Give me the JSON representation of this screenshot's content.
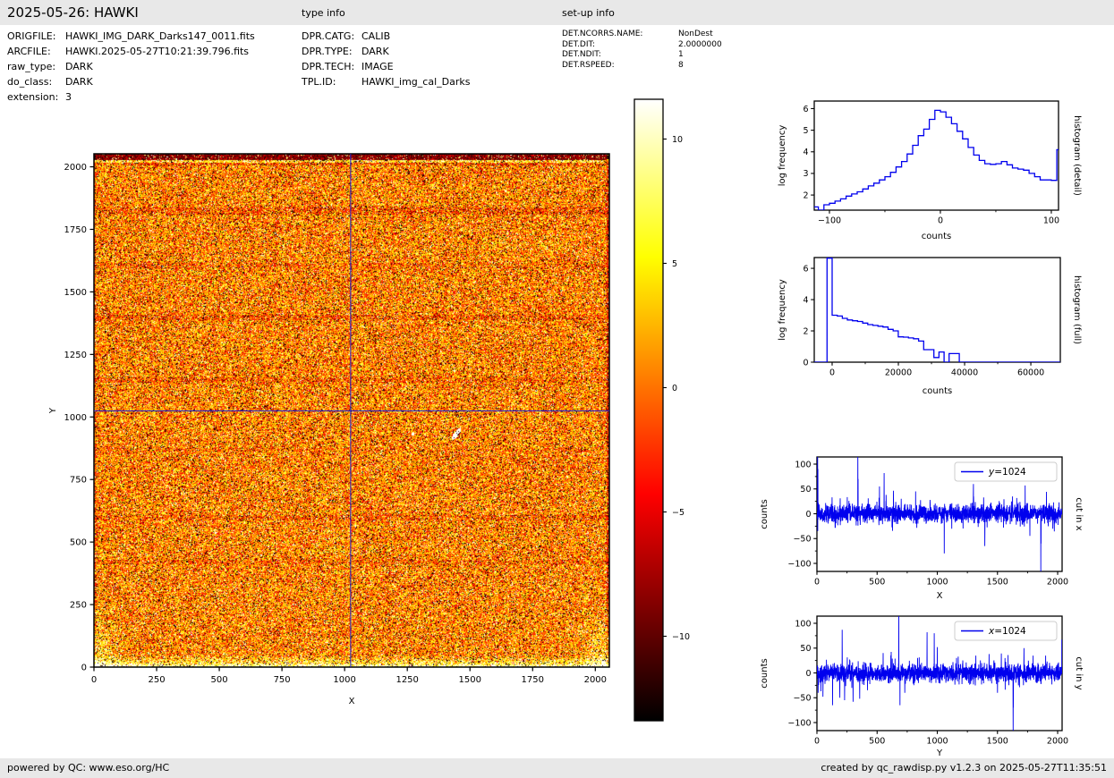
{
  "header": {
    "title": "2025-05-26: HAWKI",
    "type_info_label": "type info",
    "setup_info_label": "set-up info"
  },
  "file_info": {
    "rows": [
      {
        "label": "ORIGFILE:",
        "value": "HAWKI_IMG_DARK_Darks147_0011.fits"
      },
      {
        "label": "ARCFILE:",
        "value": "HAWKI.2025-05-27T10:21:39.796.fits"
      },
      {
        "label": "raw_type:",
        "value": "DARK"
      },
      {
        "label": "do_class:",
        "value": "DARK"
      },
      {
        "label": "extension:",
        "value": "3"
      }
    ]
  },
  "type_info": {
    "rows": [
      {
        "label": "DPR.CATG:",
        "value": "CALIB"
      },
      {
        "label": "DPR.TYPE:",
        "value": "DARK"
      },
      {
        "label": "DPR.TECH:",
        "value": "IMAGE"
      },
      {
        "label": "TPL.ID:",
        "value": "HAWKI_img_cal_Darks"
      }
    ]
  },
  "setup_info": {
    "rows": [
      {
        "label": "DET.NCORRS.NAME:",
        "value": "NonDest"
      },
      {
        "label": "DET.DIT:",
        "value": "2.0000000"
      },
      {
        "label": "DET.NDIT:",
        "value": "1"
      },
      {
        "label": "DET.RSPEED:",
        "value": "8"
      }
    ]
  },
  "footer": {
    "left": "powered by QC: www.eso.org/HC",
    "right": "created by qc_rawdisp.py v1.2.3 on 2025-05-27T11:35:51"
  },
  "colors": {
    "line_blue": "#0000ee",
    "crosshair_blue": "#2222cc",
    "bar_gray": "#e8e8e8",
    "spine_black": "#000000"
  },
  "chart_data": [
    {
      "id": "main_image",
      "type": "heatmap",
      "title": "",
      "xlabel": "X",
      "ylabel": "Y",
      "xlim": [
        0,
        2056
      ],
      "ylim": [
        0,
        2052
      ],
      "x_ticks": [
        0,
        250,
        500,
        750,
        1000,
        1250,
        1500,
        1750,
        2000
      ],
      "y_ticks": [
        0,
        250,
        500,
        750,
        1000,
        1250,
        1500,
        1750,
        2000
      ],
      "colormap": "hot",
      "vmin": -13.2,
      "vmax": 11.8,
      "crosshair": {
        "x": 1024,
        "y": 1024
      },
      "description": "2048x2048 raw dark frame: orange/red gaussian noise with black and white speckles, dark top rows with a bright streak under them, bright bottom rows and corners, faint dark horizontal bands, white cosmetic blob near (1445,935)"
    },
    {
      "id": "colorbar",
      "type": "colorbar",
      "vmin": -13.4,
      "vmax": 11.6,
      "tick_values": [
        10,
        5,
        0,
        -5,
        -10
      ],
      "tick_labels": [
        "10",
        "5",
        "0",
        "−5",
        "−10"
      ],
      "gradient_stops": [
        "#000000",
        "#ff0000",
        "#ffff00",
        "#ffffff"
      ]
    },
    {
      "id": "hist_detail",
      "type": "line",
      "subtype": "step-histogram",
      "right_label": "histogram (detail)",
      "xlabel": "counts",
      "ylabel": "log frequency",
      "xlim": [
        -113.7,
        106.5
      ],
      "ylim": [
        1.3,
        6.35
      ],
      "x_major_ticks": [
        -100,
        0,
        100
      ],
      "x_major_labels": [
        "−100",
        "0",
        "100"
      ],
      "x_minor_ticks": [
        -50,
        50
      ],
      "y_major_ticks": [
        2,
        3,
        4,
        5,
        6
      ],
      "y_major_labels": [
        "2",
        "3",
        "4",
        "5",
        "6"
      ],
      "bin_start": -115,
      "bin_width": 5,
      "values": [
        1.45,
        1.3,
        1.55,
        1.62,
        1.72,
        1.82,
        1.95,
        2.05,
        2.15,
        2.28,
        2.42,
        2.55,
        2.7,
        2.85,
        3.05,
        3.3,
        3.55,
        3.9,
        4.3,
        4.75,
        5.05,
        5.5,
        5.92,
        5.85,
        5.6,
        5.3,
        4.95,
        4.6,
        4.2,
        3.85,
        3.6,
        3.45,
        3.42,
        3.45,
        3.55,
        3.4,
        3.25,
        3.2,
        3.15,
        3.0,
        2.85,
        2.7,
        2.7,
        2.68,
        4.1
      ]
    },
    {
      "id": "hist_full",
      "type": "line",
      "subtype": "step-histogram",
      "right_label": "histogram (full)",
      "xlabel": "counts",
      "ylabel": "log frequency",
      "xlim": [
        -5400,
        68900
      ],
      "ylim": [
        0,
        6.69
      ],
      "x_major_ticks": [
        0,
        20000,
        40000,
        60000
      ],
      "x_major_labels": [
        "0",
        "20000",
        "40000",
        "60000"
      ],
      "x_minor_ticks": [
        10000,
        30000,
        50000
      ],
      "y_major_ticks": [
        0,
        2,
        4,
        6
      ],
      "y_major_labels": [
        "0",
        "2",
        "4",
        "6"
      ],
      "bin_start": -1536,
      "bin_width": 1536,
      "baseline": 0,
      "values": [
        6.65,
        3.0,
        2.95,
        2.8,
        2.7,
        2.65,
        2.6,
        2.5,
        2.4,
        2.35,
        2.3,
        2.25,
        2.1,
        2.0,
        1.62,
        1.6,
        1.55,
        1.5,
        1.35,
        0.8,
        0.8,
        0.3,
        0.65,
        0.0,
        0.55,
        0.55,
        0,
        0,
        0,
        0,
        0,
        0,
        0,
        0,
        0,
        0,
        0,
        0,
        0,
        0,
        0,
        0,
        0,
        0,
        0,
        0
      ]
    },
    {
      "id": "cut_x",
      "type": "line",
      "subtype": "noisy-cut",
      "right_label": "cut in x",
      "xlabel": "X",
      "ylabel": "counts",
      "xlim": [
        0,
        2037
      ],
      "ylim": [
        -116.2,
        114.4
      ],
      "x_major_ticks": [
        0,
        500,
        1000,
        1500,
        2000
      ],
      "x_major_labels": [
        "0",
        "500",
        "1000",
        "1500",
        "2000"
      ],
      "x_minor_ticks": [
        250,
        750,
        1250,
        1750
      ],
      "y_major_ticks": [
        100,
        50,
        0,
        -50,
        -100
      ],
      "y_major_labels": [
        "100",
        "50",
        "0",
        "−50",
        "−100"
      ],
      "y_minor_ticks": [
        75,
        25,
        -25,
        -75
      ],
      "series": [
        {
          "name": "y=1024",
          "legend_var": "y",
          "legend_rest": "=1024"
        }
      ],
      "noise": {
        "seed": 42,
        "sigma": 9,
        "n": 2037
      },
      "spikes": [
        [
          6,
          128
        ],
        [
          8,
          90
        ],
        [
          340,
          132
        ],
        [
          342,
          70
        ],
        [
          520,
          55
        ],
        [
          558,
          82
        ],
        [
          575,
          38
        ],
        [
          700,
          30
        ],
        [
          820,
          45
        ],
        [
          940,
          28
        ],
        [
          1058,
          -80
        ],
        [
          1120,
          -30
        ],
        [
          1300,
          60
        ],
        [
          1302,
          35
        ],
        [
          1395,
          -65
        ],
        [
          1550,
          -28
        ],
        [
          1625,
          35
        ],
        [
          1730,
          57
        ],
        [
          1860,
          -128
        ],
        [
          1862,
          -60
        ],
        [
          1960,
          -30
        ]
      ]
    },
    {
      "id": "cut_y",
      "type": "line",
      "subtype": "noisy-cut",
      "right_label": "cut in y",
      "xlabel": "Y",
      "ylabel": "counts",
      "xlim": [
        0,
        2037
      ],
      "ylim": [
        -116.2,
        114.4
      ],
      "x_major_ticks": [
        0,
        500,
        1000,
        1500,
        2000
      ],
      "x_major_labels": [
        "0",
        "500",
        "1000",
        "1500",
        "2000"
      ],
      "x_minor_ticks": [
        250,
        750,
        1250,
        1750
      ],
      "y_major_ticks": [
        100,
        50,
        0,
        -50,
        -100
      ],
      "y_major_labels": [
        "100",
        "50",
        "0",
        "−50",
        "−100"
      ],
      "y_minor_ticks": [
        75,
        25,
        -25,
        -75
      ],
      "series": [
        {
          "name": "x=1024",
          "legend_var": "x",
          "legend_rest": "=1024"
        }
      ],
      "noise": {
        "seed": 77,
        "sigma": 9,
        "n": 2037
      },
      "spikes": [
        [
          10,
          -40
        ],
        [
          50,
          -48
        ],
        [
          130,
          -65
        ],
        [
          190,
          -50
        ],
        [
          210,
          87
        ],
        [
          230,
          -55
        ],
        [
          300,
          -58
        ],
        [
          355,
          -52
        ],
        [
          420,
          -35
        ],
        [
          550,
          40
        ],
        [
          680,
          128
        ],
        [
          690,
          -65
        ],
        [
          730,
          -40
        ],
        [
          915,
          82
        ],
        [
          975,
          80
        ],
        [
          1000,
          52
        ],
        [
          1160,
          30
        ],
        [
          1320,
          35
        ],
        [
          1430,
          38
        ],
        [
          1500,
          -40
        ],
        [
          1630,
          -128
        ],
        [
          1632,
          -70
        ],
        [
          1720,
          50
        ],
        [
          1900,
          35
        ],
        [
          2035,
          67
        ],
        [
          2040,
          -57
        ]
      ]
    }
  ]
}
